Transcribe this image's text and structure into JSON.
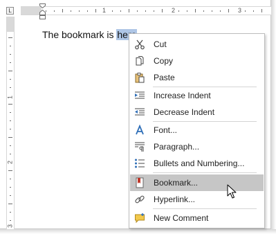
{
  "ruler": {
    "tab_label": "L",
    "h_numbers": [
      "1",
      "2",
      "3"
    ],
    "v_numbers": [
      "1",
      "2",
      "3"
    ]
  },
  "document": {
    "text_before": "The bookmark is ",
    "selected_text": "here"
  },
  "context_menu": {
    "items": [
      {
        "label": "Cut",
        "icon": "scissors-icon"
      },
      {
        "label": "Copy",
        "icon": "copy-icon"
      },
      {
        "label": "Paste",
        "icon": "paste-icon"
      },
      {
        "label": "Increase Indent",
        "icon": "increase-indent-icon"
      },
      {
        "label": "Decrease Indent",
        "icon": "decrease-indent-icon"
      },
      {
        "label": "Font...",
        "icon": "font-icon"
      },
      {
        "label": "Paragraph...",
        "icon": "paragraph-icon"
      },
      {
        "label": "Bullets and Numbering...",
        "icon": "bullets-icon"
      },
      {
        "label": "Bookmark...",
        "icon": "bookmark-icon",
        "highlighted": true
      },
      {
        "label": "Hyperlink...",
        "icon": "hyperlink-icon"
      },
      {
        "label": "New Comment",
        "icon": "new-comment-icon"
      }
    ]
  },
  "colors": {
    "selection": "#aec6e6",
    "menu_hover": "#c6c6c6",
    "icon_blue": "#2f6fb8",
    "bookmark_red": "#c0392b"
  }
}
